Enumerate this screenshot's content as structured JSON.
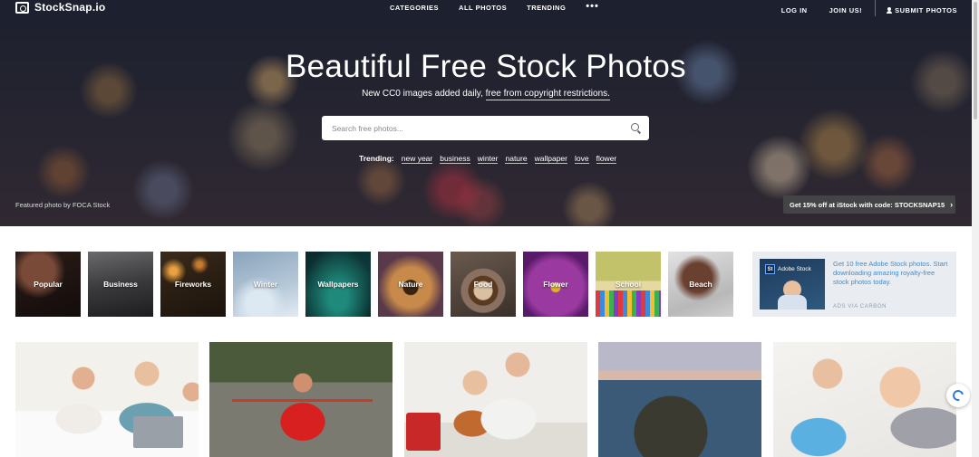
{
  "nav": {
    "logo": "StockSnap.io",
    "links": [
      "CATEGORIES",
      "ALL PHOTOS",
      "TRENDING"
    ],
    "more": "•••",
    "login": "LOG IN",
    "join": "JOIN US!",
    "submit": "SUBMIT PHOTOS"
  },
  "hero": {
    "title": "Beautiful Free Stock Photos",
    "subtitle_prefix": "New CC0 images added daily,",
    "subtitle_link": "free from copyright restrictions.",
    "search_placeholder": "Search free photos...",
    "trending_label": "Trending:",
    "trending_tags": [
      "new year",
      "business",
      "winter",
      "nature",
      "wallpaper",
      "love",
      "flower"
    ],
    "credit": "Featured photo by FOCA Stock",
    "promo": "Get 15% off at iStock with code: STOCKSNAP15"
  },
  "categories": [
    "Popular",
    "Business",
    "Fireworks",
    "Winter",
    "Wallpapers",
    "Nature",
    "Food",
    "Flower",
    "School",
    "Beach"
  ],
  "ad": {
    "logo_text": "Adobe Stock",
    "logo_mark": "St",
    "text": "Get 10 free Adobe Stock photos. Start downloading amazing royalty-free stock photos today.",
    "via": "ADS VIA CARBON"
  },
  "icons": {
    "search": "search-icon",
    "user": "user-icon",
    "camera_logo": "camera-icon",
    "chevron": "chevron-right-icon",
    "float": "translate-icon"
  }
}
